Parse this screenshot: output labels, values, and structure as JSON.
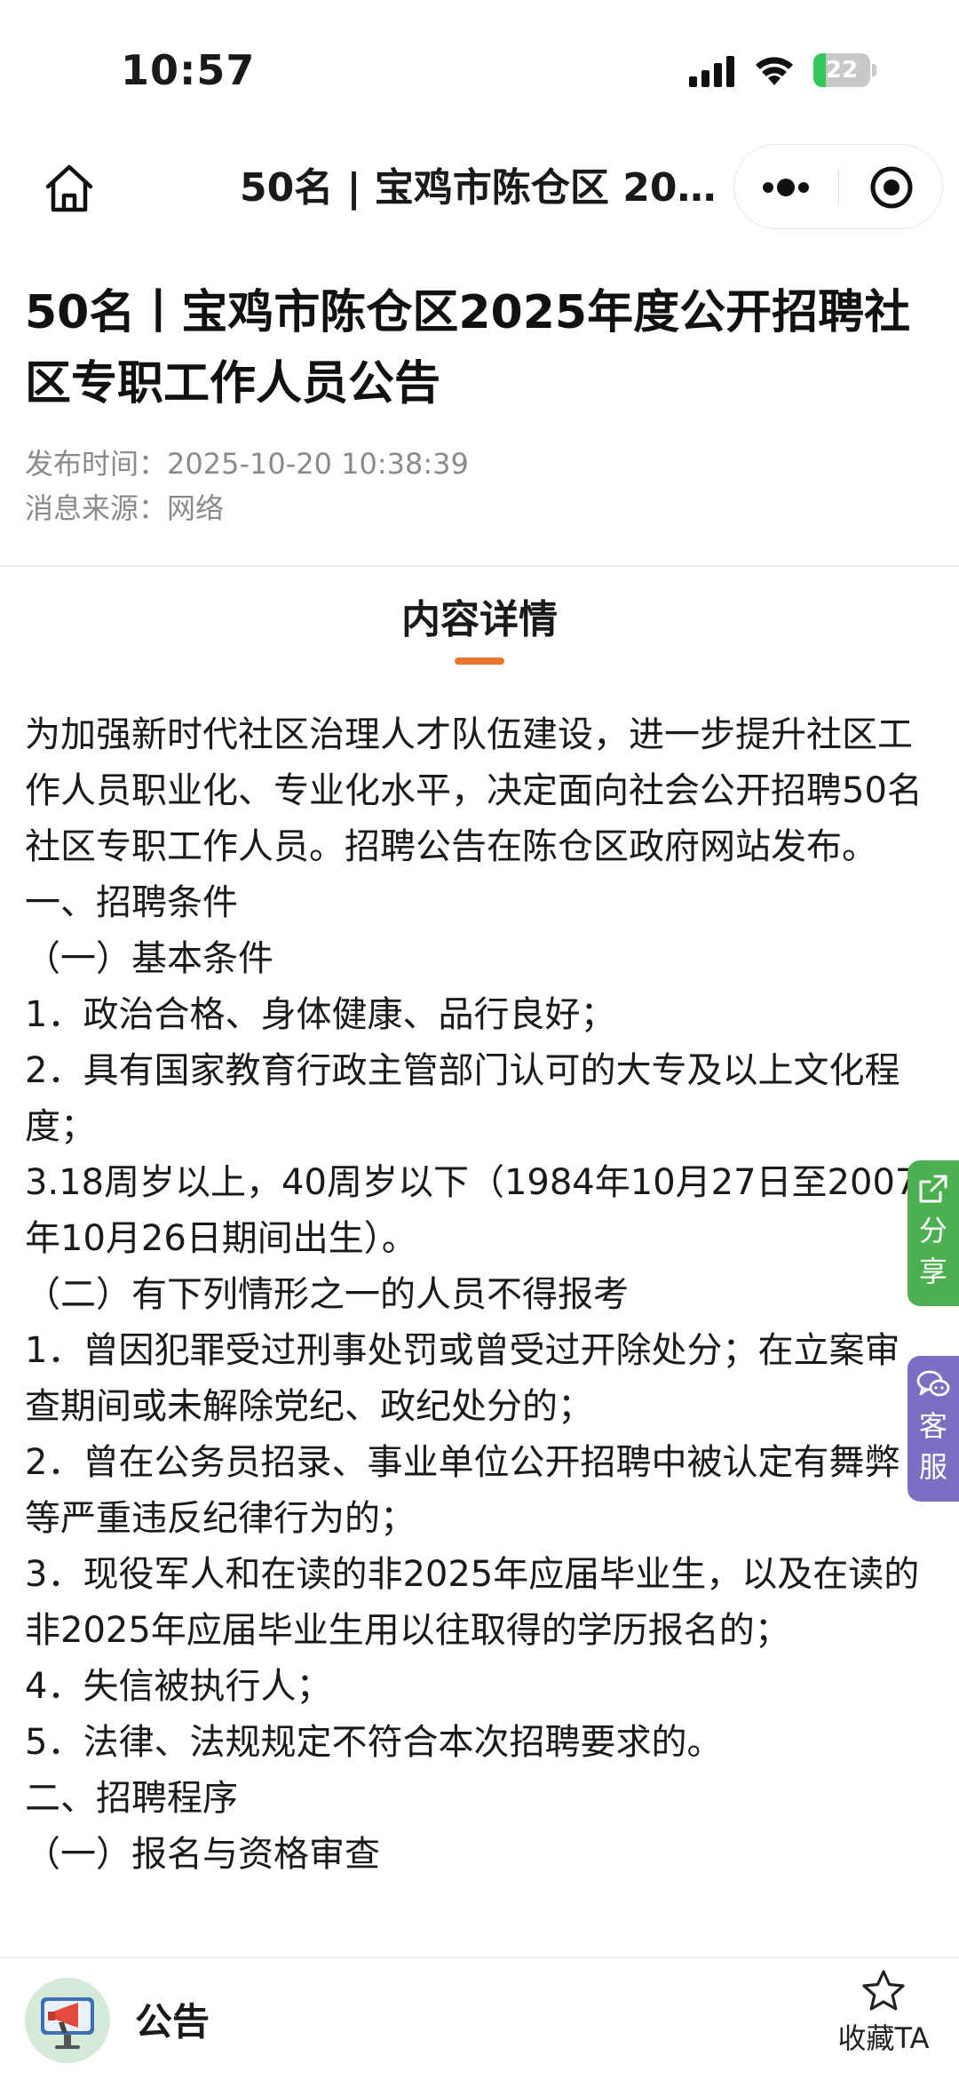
{
  "status_bar": {
    "time": "10:57",
    "battery_level": "22",
    "battery_fraction": 0.22,
    "battery_color": "#34c759"
  },
  "nav": {
    "title": "50名 | 宝鸡市陈仓区 20...",
    "home_icon": "home-icon",
    "more_icon": "more-dots-icon",
    "close_icon": "target-close-icon"
  },
  "article": {
    "title": "50名丨宝鸡市陈仓区2025年度公开招聘社区专职工作人员公告",
    "publish_label": "发布时间：",
    "publish_time": "2025-10-20 10:38:39",
    "source_label": "消息来源：",
    "source": "网络",
    "section_heading": "内容详情",
    "accent_color": "#e8762c",
    "paragraphs": [
      "为加强新时代社区治理人才队伍建设，进一步提升社区工作人员职业化、专业化水平，决定面向社会公开招聘50名社区专职工作人员。招聘公告在陈仓区政府网站发布。",
      "一、招聘条件",
      "（一）基本条件",
      "1．政治合格、身体健康、品行良好；",
      "2．具有国家教育行政主管部门认可的大专及以上文化程度；",
      "3.18周岁以上，40周岁以下（1984年10月27日至2007年10月26日期间出生）。",
      "（二）有下列情形之一的人员不得报考",
      "1．曾因犯罪受过刑事处罚或曾受过开除处分；在立案审查期间或未解除党纪、政纪处分的；",
      "2．曾在公务员招录、事业单位公开招聘中被认定有舞弊等严重违反纪律行为的；",
      "3．现役军人和在读的非2025年应届毕业生，以及在读的非2025年应届毕业生用以往取得的学历报名的；",
      "4．失信被执行人；",
      "5．法律、法规规定不符合本次招聘要求的。",
      "二、招聘程序",
      "（一）报名与资格审查"
    ]
  },
  "floating": {
    "share_label_1": "分",
    "share_label_2": "享",
    "share_color": "#4caf50",
    "service_label_1": "客",
    "service_label_2": "服",
    "service_color": "#7b6fc2"
  },
  "bottom_bar": {
    "name": "公告",
    "favorite_label": "收藏TA",
    "avatar_icon": "megaphone-icon",
    "favorite_icon": "star-icon"
  }
}
